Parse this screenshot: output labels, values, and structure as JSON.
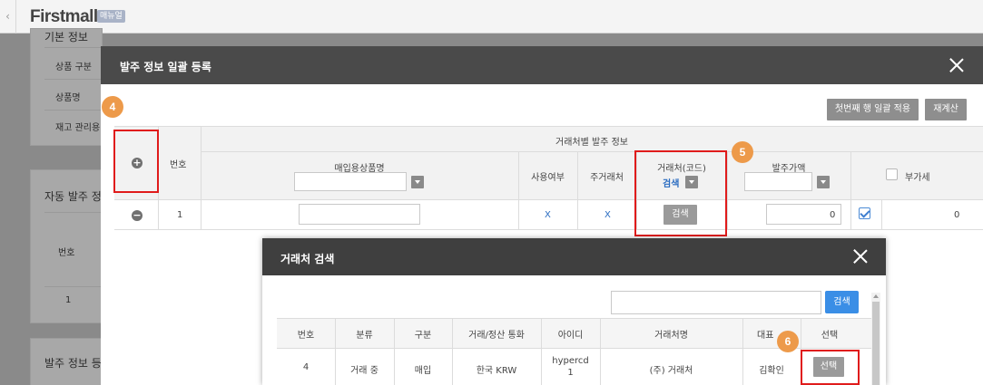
{
  "app": {
    "brand": "Firstmall",
    "manual_badge": "매뉴얼"
  },
  "background": {
    "basic_info_title": "기본 정보",
    "rows": [
      "상품 구분",
      "상품명",
      "재고 관리용"
    ],
    "auto_order_title": "자동 발주 정",
    "num_header": "번호",
    "row_number": "1",
    "order_info_title": "발주 정보 등"
  },
  "modal": {
    "title": "발주 정보 일괄 등록",
    "apply_first_row_label": "첫번째 행 일괄 적용",
    "recalc_label": "재계산",
    "table": {
      "group_header": "거래처별 발주 정보",
      "col_number": "번호",
      "col_purchase_name": "매입용상품명",
      "col_use": "사용여부",
      "col_main_vendor": "주거래처",
      "col_vendor_code": "거래처(코드)",
      "col_vendor_search_link": "검색",
      "col_order_price": "발주가액",
      "col_vat": "부가세",
      "row": {
        "number": "1",
        "use": "X",
        "main_vendor": "X",
        "search_button": "검색",
        "price": "0",
        "vat_value": "0",
        "vat_checked": true
      }
    }
  },
  "vendor_search": {
    "title": "거래처 검색",
    "search_button": "검색",
    "search_value": "",
    "columns": [
      "번호",
      "분류",
      "구분",
      "거래/정산 통화",
      "아이디",
      "거래처명",
      "대표",
      "선택"
    ],
    "rows": [
      {
        "number": "4",
        "category": "거래 중",
        "type": "매입",
        "currency": "한국 KRW",
        "id": "hypercd\n1",
        "name": "(주) 거래처",
        "ceo": "김확인",
        "select": "선택"
      }
    ]
  },
  "steps": [
    "4",
    "5",
    "6"
  ],
  "colors": {
    "highlight": "#e01b1b",
    "step_badge": "#ed9a4a",
    "link": "#2a6cc1",
    "primary": "#3a8ee6"
  }
}
